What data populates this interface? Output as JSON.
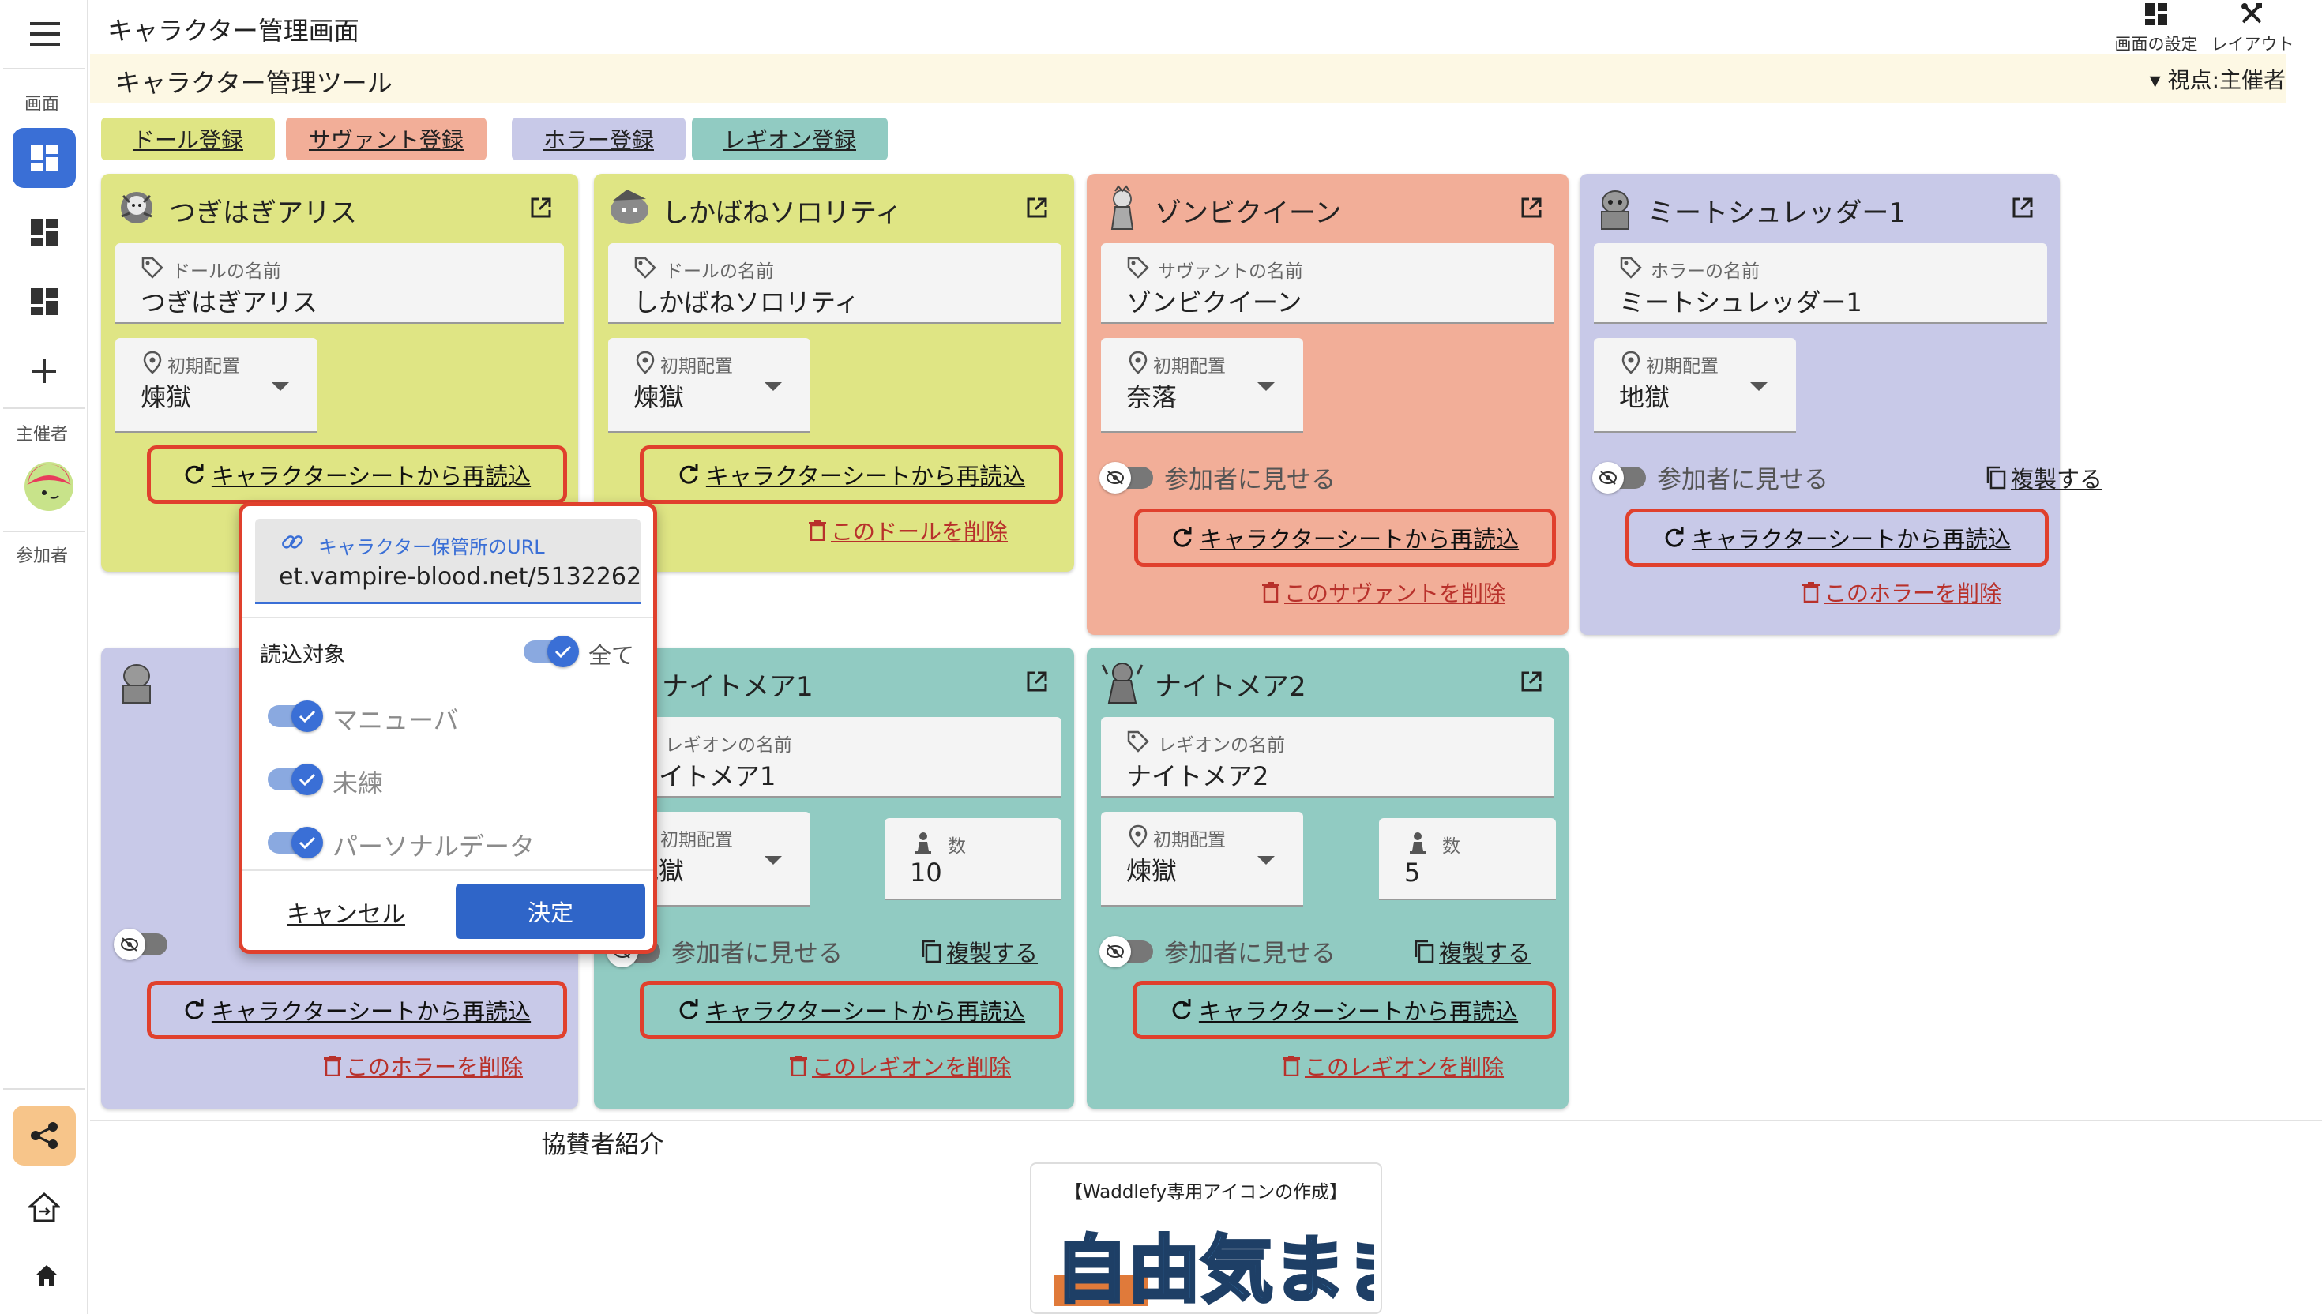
{
  "app": {
    "title": "キャラクター管理画面"
  },
  "sidebar": {
    "section_screen": "画面",
    "section_host": "主催者",
    "section_participant": "参加者"
  },
  "top_tools": {
    "screen_settings": "画面の設定",
    "layout": "レイアウト"
  },
  "toolbar": {
    "subtitle": "キャラクター管理ツール",
    "perspective": "▾ 視点:主催者"
  },
  "register_buttons": [
    {
      "label": "ドール登録",
      "color": "#dfe584"
    },
    {
      "label": "サヴァント登録",
      "color": "#f2ae98"
    },
    {
      "label": "ホラー登録",
      "color": "#c8c9e8"
    },
    {
      "label": "レギオン登録",
      "color": "#91cbc2"
    }
  ],
  "labels": {
    "placement": "初期配置",
    "count": "数",
    "show": "参加者に見せる",
    "duplicate": "複製する",
    "reload": "キャラクターシートから再読込"
  },
  "cards": {
    "alice": {
      "name": "つぎはぎアリス",
      "name_label": "ドールの名前",
      "placement": "煉獄"
    },
    "sorority": {
      "name": "しかばねソロリティ",
      "name_label": "ドールの名前",
      "placement": "煉獄",
      "delete": "このドールを削除"
    },
    "zombie": {
      "name": "ゾンビクイーン",
      "name_label": "サヴァントの名前",
      "placement": "奈落",
      "delete": "このサヴァントを削除"
    },
    "meat": {
      "name": "ミートシュレッダー1",
      "name_label": "ホラーの名前",
      "placement": "地獄",
      "delete": "このホラーを削除"
    },
    "horror2": {
      "delete": "このホラーを削除"
    },
    "nightmare1": {
      "name": "ナイトメア1",
      "name_label": "レギオンの名前",
      "placement": "地獄",
      "count": "10",
      "delete": "このレギオンを削除"
    },
    "nightmare2": {
      "name": "ナイトメア2",
      "name_label": "レギオンの名前",
      "placement": "煉獄",
      "count": "5",
      "delete": "このレギオンを削除"
    }
  },
  "popup": {
    "url_label": "キャラクター保管所のURL",
    "url_value": "et.vampire-blood.net/5132262",
    "target_label": "読込対象",
    "all_label": "全て",
    "options": [
      "マニューバ",
      "未練",
      "パーソナルデータ"
    ],
    "cancel": "キャンセル",
    "ok": "決定"
  },
  "sponsor": {
    "title": "協賛者紹介",
    "text": "【Waddlefy専用アイコンの作成】",
    "logo": "自由気まま"
  }
}
